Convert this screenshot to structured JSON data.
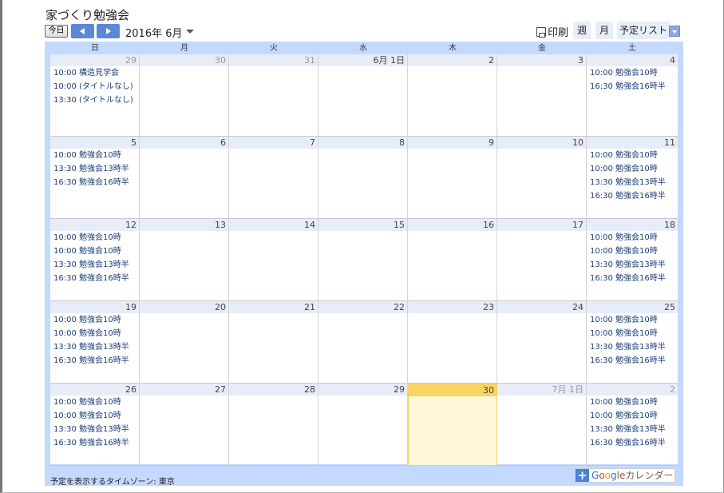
{
  "title": "家づくり勉強会",
  "toolbar": {
    "today": "今日",
    "current": "2016年 6月",
    "print": "印刷",
    "week": "週",
    "month": "月",
    "agenda": "予定リスト"
  },
  "weekdays": [
    "日",
    "月",
    "火",
    "水",
    "木",
    "金",
    "土"
  ],
  "weeks": [
    [
      {
        "label": "29",
        "other": true,
        "events": [
          {
            "time": "10:00",
            "title": "構造見学会"
          },
          {
            "time": "10:00",
            "title": "(タイトルなし)"
          },
          {
            "time": "13:30",
            "title": "(タイトルなし)"
          }
        ]
      },
      {
        "label": "30",
        "other": true,
        "events": []
      },
      {
        "label": "31",
        "other": true,
        "events": []
      },
      {
        "label": "6月 1日",
        "events": []
      },
      {
        "label": "2",
        "events": []
      },
      {
        "label": "3",
        "events": []
      },
      {
        "label": "4",
        "events": [
          {
            "time": "10:00",
            "title": "勉強会10時"
          },
          {
            "time": "16:30",
            "title": "勉強会16時半"
          }
        ]
      }
    ],
    [
      {
        "label": "5",
        "events": [
          {
            "time": "10:00",
            "title": "勉強会10時"
          },
          {
            "time": "13:30",
            "title": "勉強会13時半"
          },
          {
            "time": "16:30",
            "title": "勉強会16時半"
          }
        ]
      },
      {
        "label": "6",
        "events": []
      },
      {
        "label": "7",
        "events": []
      },
      {
        "label": "8",
        "events": []
      },
      {
        "label": "9",
        "events": []
      },
      {
        "label": "10",
        "events": []
      },
      {
        "label": "11",
        "events": [
          {
            "time": "10:00",
            "title": "勉強会10時"
          },
          {
            "time": "10:00",
            "title": "勉強会10時"
          },
          {
            "time": "13:30",
            "title": "勉強会13時半"
          },
          {
            "time": "16:30",
            "title": "勉強会16時半"
          }
        ]
      }
    ],
    [
      {
        "label": "12",
        "events": [
          {
            "time": "10:00",
            "title": "勉強会10時"
          },
          {
            "time": "10:00",
            "title": "勉強会10時"
          },
          {
            "time": "13:30",
            "title": "勉強会13時半"
          },
          {
            "time": "16:30",
            "title": "勉強会16時半"
          }
        ]
      },
      {
        "label": "13",
        "events": []
      },
      {
        "label": "14",
        "events": []
      },
      {
        "label": "15",
        "events": []
      },
      {
        "label": "16",
        "events": []
      },
      {
        "label": "17",
        "events": []
      },
      {
        "label": "18",
        "events": [
          {
            "time": "10:00",
            "title": "勉強会10時"
          },
          {
            "time": "10:00",
            "title": "勉強会10時"
          },
          {
            "time": "13:30",
            "title": "勉強会13時半"
          },
          {
            "time": "16:30",
            "title": "勉強会16時半"
          }
        ]
      }
    ],
    [
      {
        "label": "19",
        "events": [
          {
            "time": "10:00",
            "title": "勉強会10時"
          },
          {
            "time": "10:00",
            "title": "勉強会10時"
          },
          {
            "time": "13:30",
            "title": "勉強会13時半"
          },
          {
            "time": "16:30",
            "title": "勉強会16時半"
          }
        ]
      },
      {
        "label": "20",
        "events": []
      },
      {
        "label": "21",
        "events": []
      },
      {
        "label": "22",
        "events": []
      },
      {
        "label": "23",
        "events": []
      },
      {
        "label": "24",
        "events": []
      },
      {
        "label": "25",
        "events": [
          {
            "time": "10:00",
            "title": "勉強会10時"
          },
          {
            "time": "10:00",
            "title": "勉強会10時"
          },
          {
            "time": "13:30",
            "title": "勉強会13時半"
          },
          {
            "time": "16:30",
            "title": "勉強会16時半"
          }
        ]
      }
    ],
    [
      {
        "label": "26",
        "events": [
          {
            "time": "10:00",
            "title": "勉強会10時"
          },
          {
            "time": "10:00",
            "title": "勉強会10時"
          },
          {
            "time": "13:30",
            "title": "勉強会13時半"
          },
          {
            "time": "16:30",
            "title": "勉強会16時半"
          }
        ]
      },
      {
        "label": "27",
        "events": []
      },
      {
        "label": "28",
        "events": []
      },
      {
        "label": "29",
        "events": []
      },
      {
        "label": "30",
        "today": true,
        "events": []
      },
      {
        "label": "7月 1日",
        "other": true,
        "events": []
      },
      {
        "label": "2",
        "other": true,
        "events": [
          {
            "time": "10:00",
            "title": "勉強会10時"
          },
          {
            "time": "10:00",
            "title": "勉強会10時"
          },
          {
            "time": "13:30",
            "title": "勉強会13時半"
          },
          {
            "time": "16:30",
            "title": "勉強会16時半"
          }
        ]
      }
    ]
  ],
  "footer": {
    "timezone": "予定を表示するタイムゾーン: 東京",
    "badge_plus": "+",
    "badge_g": [
      "G",
      "o",
      "o",
      "g",
      "l",
      "e"
    ],
    "badge_text": "カレンダー"
  }
}
